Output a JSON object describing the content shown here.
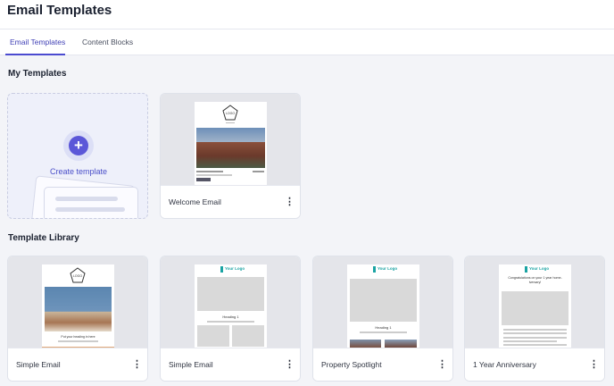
{
  "header": {
    "title": "Email Templates"
  },
  "tabs": [
    {
      "label": "Email Templates",
      "active": true
    },
    {
      "label": "Content Blocks",
      "active": false
    }
  ],
  "sections": {
    "my_templates": "My Templates",
    "template_library": "Template Library"
  },
  "create_card": {
    "label": "Create template",
    "icon": "plus-icon"
  },
  "my_templates": [
    {
      "name": "Welcome Email",
      "menu_icon": "more-vertical-icon"
    }
  ],
  "library": [
    {
      "name": "Simple Email",
      "menu_icon": "more-vertical-icon"
    },
    {
      "name": "Simple Email",
      "menu_icon": "more-vertical-icon"
    },
    {
      "name": "Property Spotlight",
      "menu_icon": "more-vertical-icon"
    },
    {
      "name": "1 Year Anniversary",
      "menu_icon": "more-vertical-icon"
    }
  ],
  "thumb_text": {
    "logo": "LOGO",
    "your_logo": "Your Logo",
    "heading": "Heading 1",
    "simple_caption": "Put your heading in here",
    "anniversary_heading": "Congratulations on your 1 year home-iversary!"
  },
  "colors": {
    "accent": "#4b4bd0",
    "teal": "#1aa3a3"
  }
}
